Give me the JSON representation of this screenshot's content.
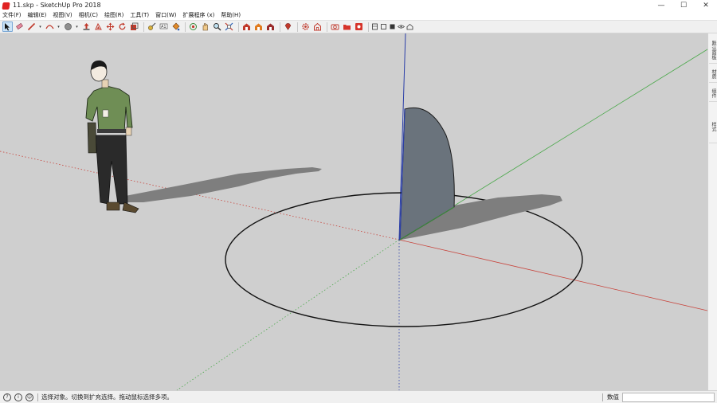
{
  "window": {
    "title": "11.skp - SketchUp Pro 2018",
    "minimize": "—",
    "maximize": "☐",
    "close": "✕"
  },
  "menu": [
    "文件(F)",
    "编辑(E)",
    "视图(V)",
    "相机(C)",
    "绘图(R)",
    "工具(T)",
    "窗口(W)",
    "扩展程序 (x)",
    "帮助(H)"
  ],
  "toolbar": {
    "active_tool": "select",
    "colors": {
      "red": "#d6342a",
      "orange": "#e07b1f",
      "blue": "#2a5fb8",
      "green": "#3a9a3a",
      "gray": "#777777"
    }
  },
  "scene": {
    "background": "#cfcfcf",
    "axes": {
      "red": "#c8443c",
      "green": "#4aa84a",
      "blue": "#2b3fa8"
    },
    "shape_fill": "#6a737c",
    "shadow": "#7e7e7e"
  },
  "side_tray": {
    "tabs": [
      "默认面板",
      "材质",
      "组件",
      "样式"
    ]
  },
  "status": {
    "message": "选择对象。切换到扩充选择。拖动鼠标选择多项。",
    "measure_label": "数值",
    "measure_value": ""
  }
}
